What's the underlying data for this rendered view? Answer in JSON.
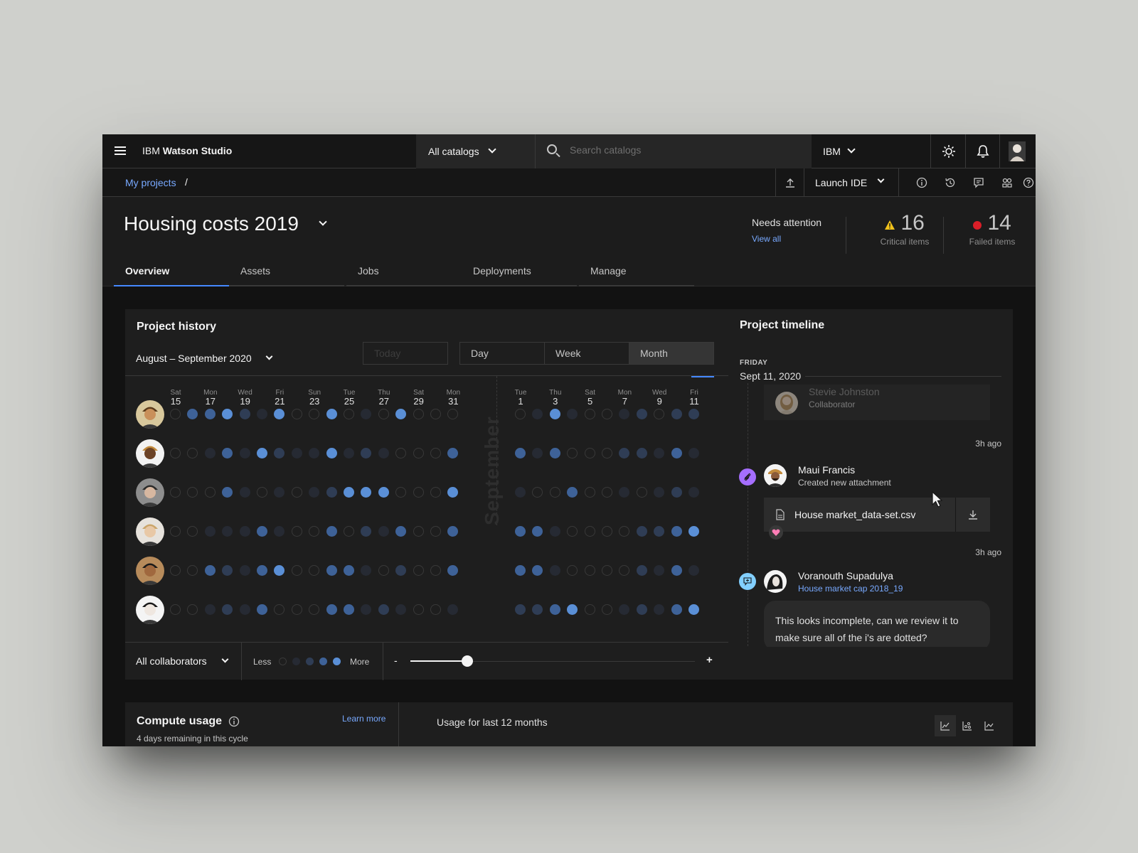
{
  "header": {
    "brand_prefix": "IBM",
    "brand_name": "Watson Studio",
    "catalog_select": "All catalogs",
    "search_placeholder": "Search catalogs",
    "account": "IBM"
  },
  "breadcrumb": {
    "root": "My projects",
    "separator": "/"
  },
  "toolbar": {
    "launch_label": "Launch IDE"
  },
  "project": {
    "title": "Housing costs 2019",
    "tabs": [
      "Overview",
      "Assets",
      "Jobs",
      "Deployments",
      "Manage"
    ],
    "active_tab": "Overview",
    "needs_attention": "Needs attention",
    "view_all": "View all",
    "critical_count": "16",
    "critical_label": "Critical items",
    "failed_count": "14",
    "failed_label": "Failed items"
  },
  "history": {
    "title": "Project history",
    "range": "August – September 2020",
    "today_label": "Today",
    "views": [
      "Day",
      "Week",
      "Month"
    ],
    "selected_view": "Month",
    "month_watermark": "September",
    "days_aug": [
      {
        "dow": "Sat",
        "d": "15"
      },
      {
        "dow": "Mon",
        "d": "17"
      },
      {
        "dow": "Wed",
        "d": "19"
      },
      {
        "dow": "Fri",
        "d": "21"
      },
      {
        "dow": "Sun",
        "d": "23"
      },
      {
        "dow": "Tue",
        "d": "25"
      },
      {
        "dow": "Thu",
        "d": "27"
      },
      {
        "dow": "Sat",
        "d": "29"
      },
      {
        "dow": "Mon",
        "d": "31"
      }
    ],
    "days_sep": [
      {
        "dow": "Tue",
        "d": "1"
      },
      {
        "dow": "Thu",
        "d": "3"
      },
      {
        "dow": "Sat",
        "d": "5"
      },
      {
        "dow": "Mon",
        "d": "7"
      },
      {
        "dow": "Wed",
        "d": "9"
      },
      {
        "dow": "Fri",
        "d": "11"
      }
    ],
    "activity_aug": [
      [
        0,
        3,
        3,
        4,
        2,
        1,
        4,
        0,
        0,
        4,
        0,
        1,
        0,
        4,
        0,
        0,
        0
      ],
      [
        0,
        0,
        1,
        3,
        1,
        4,
        2,
        1,
        1,
        4,
        1,
        2,
        1,
        0,
        0,
        0,
        3
      ],
      [
        0,
        0,
        0,
        3,
        1,
        0,
        1,
        0,
        1,
        2,
        4,
        4,
        4,
        0,
        0,
        0,
        4
      ],
      [
        0,
        0,
        1,
        1,
        1,
        3,
        1,
        0,
        0,
        3,
        0,
        2,
        1,
        3,
        0,
        0,
        3
      ],
      [
        0,
        0,
        3,
        2,
        1,
        3,
        4,
        0,
        0,
        3,
        3,
        1,
        0,
        2,
        0,
        0,
        3
      ],
      [
        0,
        0,
        1,
        2,
        1,
        3,
        0,
        0,
        0,
        3,
        3,
        1,
        2,
        1,
        0,
        0,
        1
      ]
    ],
    "activity_sep": [
      [
        0,
        1,
        4,
        1,
        0,
        0,
        1,
        2,
        0,
        2,
        2
      ],
      [
        3,
        1,
        3,
        0,
        0,
        0,
        2,
        2,
        1,
        3,
        1
      ],
      [
        1,
        0,
        0,
        3,
        0,
        0,
        1,
        0,
        1,
        2,
        1
      ],
      [
        3,
        3,
        1,
        0,
        0,
        0,
        0,
        2,
        2,
        3,
        4
      ],
      [
        3,
        3,
        1,
        0,
        0,
        0,
        0,
        2,
        1,
        3,
        1
      ],
      [
        2,
        2,
        3,
        4,
        0,
        0,
        1,
        2,
        1,
        3,
        4
      ]
    ],
    "collaborators_select": "All collaborators",
    "legend_less": "Less",
    "legend_more": "More",
    "zoom_minus": "-",
    "zoom_plus": "+",
    "zoom_level": 0.2
  },
  "timeline": {
    "title": "Project timeline",
    "day_label": "FRIDAY",
    "date": "Sept 11, 2020",
    "items": [
      {
        "name": "Stevie Johnston",
        "detail": "Collaborator",
        "time": "3h ago"
      },
      {
        "name": "Maui Francis",
        "detail": "Created new attachment",
        "file": "House market_data-set.csv",
        "time": "3h ago"
      },
      {
        "name": "Voranouth Supadulya",
        "detail": "House market cap 2018_19",
        "comment": "This looks incomplete, can we review it to make sure all of the i's are dotted?"
      }
    ]
  },
  "compute": {
    "title": "Compute usage",
    "learn_more": "Learn more",
    "remaining": "4 days remaining in this cycle",
    "usage_title": "Usage for last 12 months"
  },
  "colors": {
    "accent": "#4589ff",
    "link": "#78a9ff",
    "warning": "#f1c21b",
    "error": "#da1e28",
    "attachment_badge": "#a56eff",
    "comment_badge": "#82cfff",
    "reaction": "#ff7eb6"
  }
}
